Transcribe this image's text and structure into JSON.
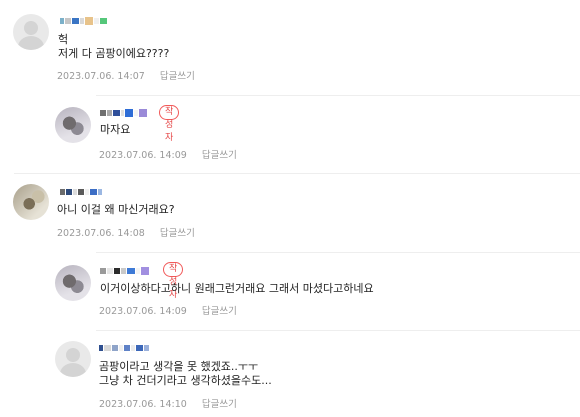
{
  "badges": {
    "author": "작성자"
  },
  "reply_label": "답글쓰기",
  "comments": [
    {
      "text_lines": [
        "헉",
        "저게 다 곰팡이에요????"
      ],
      "date": "2023.07.06. 14:07"
    },
    {
      "text_lines": [
        "마자요"
      ],
      "date": "2023.07.06. 14:09"
    },
    {
      "text_lines": [
        "아니 이걸 왜 마신거래요?"
      ],
      "date": "2023.07.06. 14:08"
    },
    {
      "text_lines": [
        "이거이상하다고하니 원래그런거래요 그래서 마셨다고하네요"
      ],
      "date": "2023.07.06. 14:09"
    },
    {
      "text_lines": [
        "곰팡이라고 생각을 못 했겠죠..ㅜㅜ",
        "그냥 차 건더기라고 생각하셨을수도..."
      ],
      "date": "2023.07.06. 14:10"
    }
  ]
}
